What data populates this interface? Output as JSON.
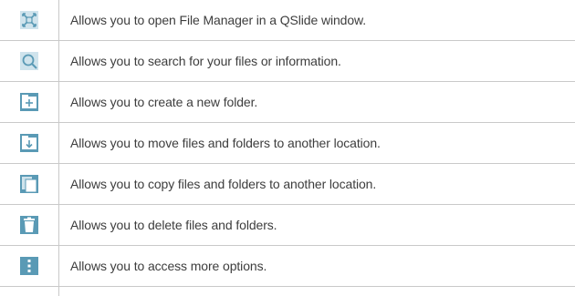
{
  "rows": [
    {
      "icon": "qslide-icon",
      "text": "Allows you to open File Manager in a QSlide window."
    },
    {
      "icon": "search-icon",
      "text": "Allows you to search for your files or information."
    },
    {
      "icon": "new-folder-icon",
      "text": "Allows you to create a new folder."
    },
    {
      "icon": "move-folder-icon",
      "text": "Allows you to move files and folders to another location."
    },
    {
      "icon": "copy-icon",
      "text": "Allows you to copy files and folders to another location."
    },
    {
      "icon": "delete-icon",
      "text": "Allows you to delete files and folders."
    },
    {
      "icon": "more-options-icon",
      "text": "Allows you to access more options."
    }
  ],
  "colors": {
    "icon_fill": "#5a9ab5",
    "icon_bg": "#cfe3ec",
    "rule": "#c9c9c9",
    "text": "#3d3d3d"
  }
}
